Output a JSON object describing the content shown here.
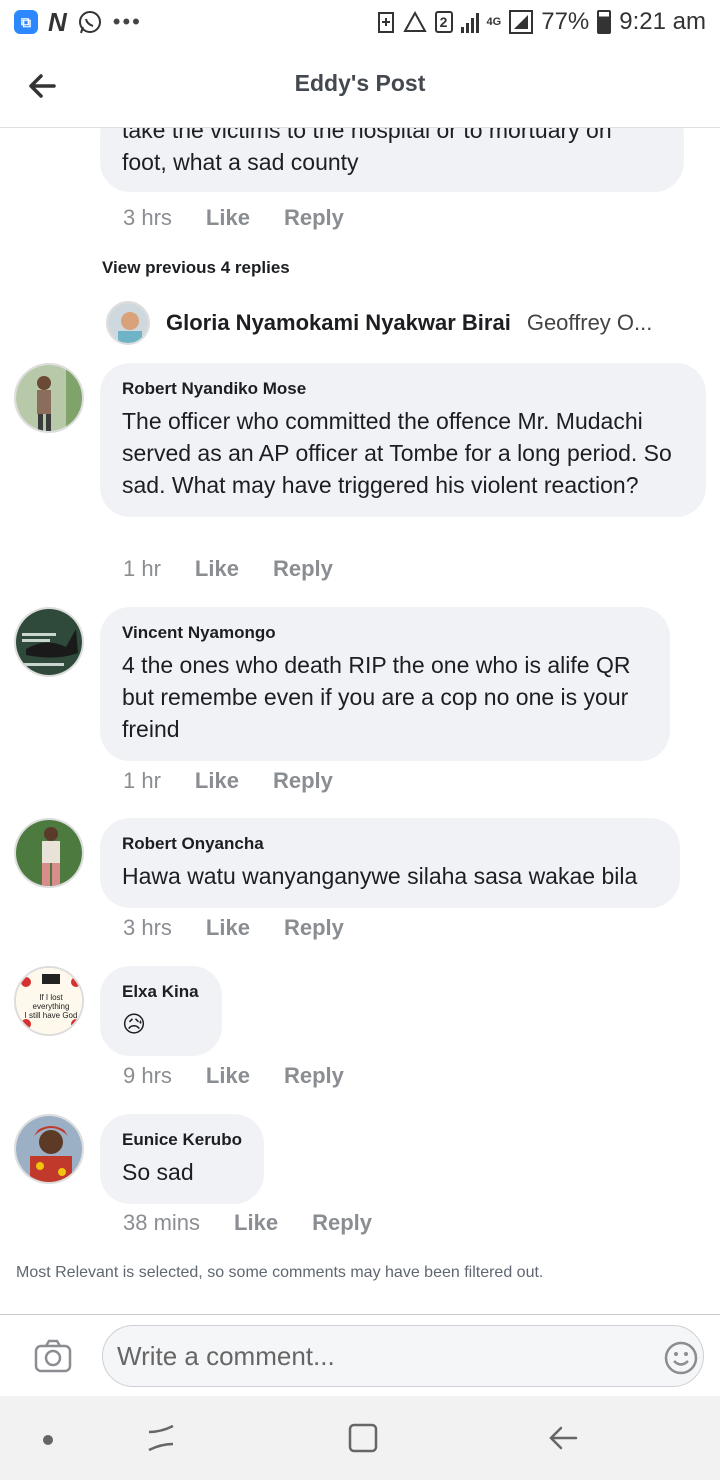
{
  "status_bar": {
    "battery": "77%",
    "time": "9:21 am",
    "sim_badge": "2",
    "network": "4G",
    "dots": "•••"
  },
  "header": {
    "title": "Eddy's Post"
  },
  "parent_comment": {
    "text": "take the victims to the hospital or to mortuary on foot, what a sad  county",
    "time": "3 hrs",
    "like": "Like",
    "reply": "Reply"
  },
  "replies": {
    "view_previous": "View previous 4 replies",
    "preview_name": "Gloria Nyamokami Nyakwar Birai",
    "preview_text": "Geoffrey O..."
  },
  "comments": [
    {
      "author": "Robert Nyandiko Mose",
      "text": "The officer who committed the offence Mr. Mudachi served as an AP officer at Tombe for a long period. So sad. What may have triggered his violent reaction?",
      "time": "1 hr",
      "like": "Like",
      "reply": "Reply"
    },
    {
      "author": "Vincent Nyamongo",
      "text": "4 the ones who death RIP the one who is alife QR but remembe even if you are a cop no one is your freind",
      "time": "1 hr",
      "like": "Like",
      "reply": "Reply"
    },
    {
      "author": "Robert Onyancha",
      "text": "Hawa watu wanyanganywe silaha sasa wakae bila",
      "time": "3 hrs",
      "like": "Like",
      "reply": "Reply"
    },
    {
      "author": "Elxa Kina",
      "text": "😥",
      "time": "9 hrs",
      "like": "Like",
      "reply": "Reply"
    },
    {
      "author": "Eunice Kerubo",
      "text": "So sad",
      "time": "38 mins",
      "like": "Like",
      "reply": "Reply"
    }
  ],
  "avatar_4_caption": "If I lost everything I still have God",
  "filter_note": "Most Relevant is selected, so some comments may have been filtered out.",
  "composer": {
    "placeholder": "Write a comment..."
  },
  "colors": {
    "bubble": "#f0f2f5",
    "meta_text": "#8a8d91",
    "accent": "#2d88ff"
  }
}
